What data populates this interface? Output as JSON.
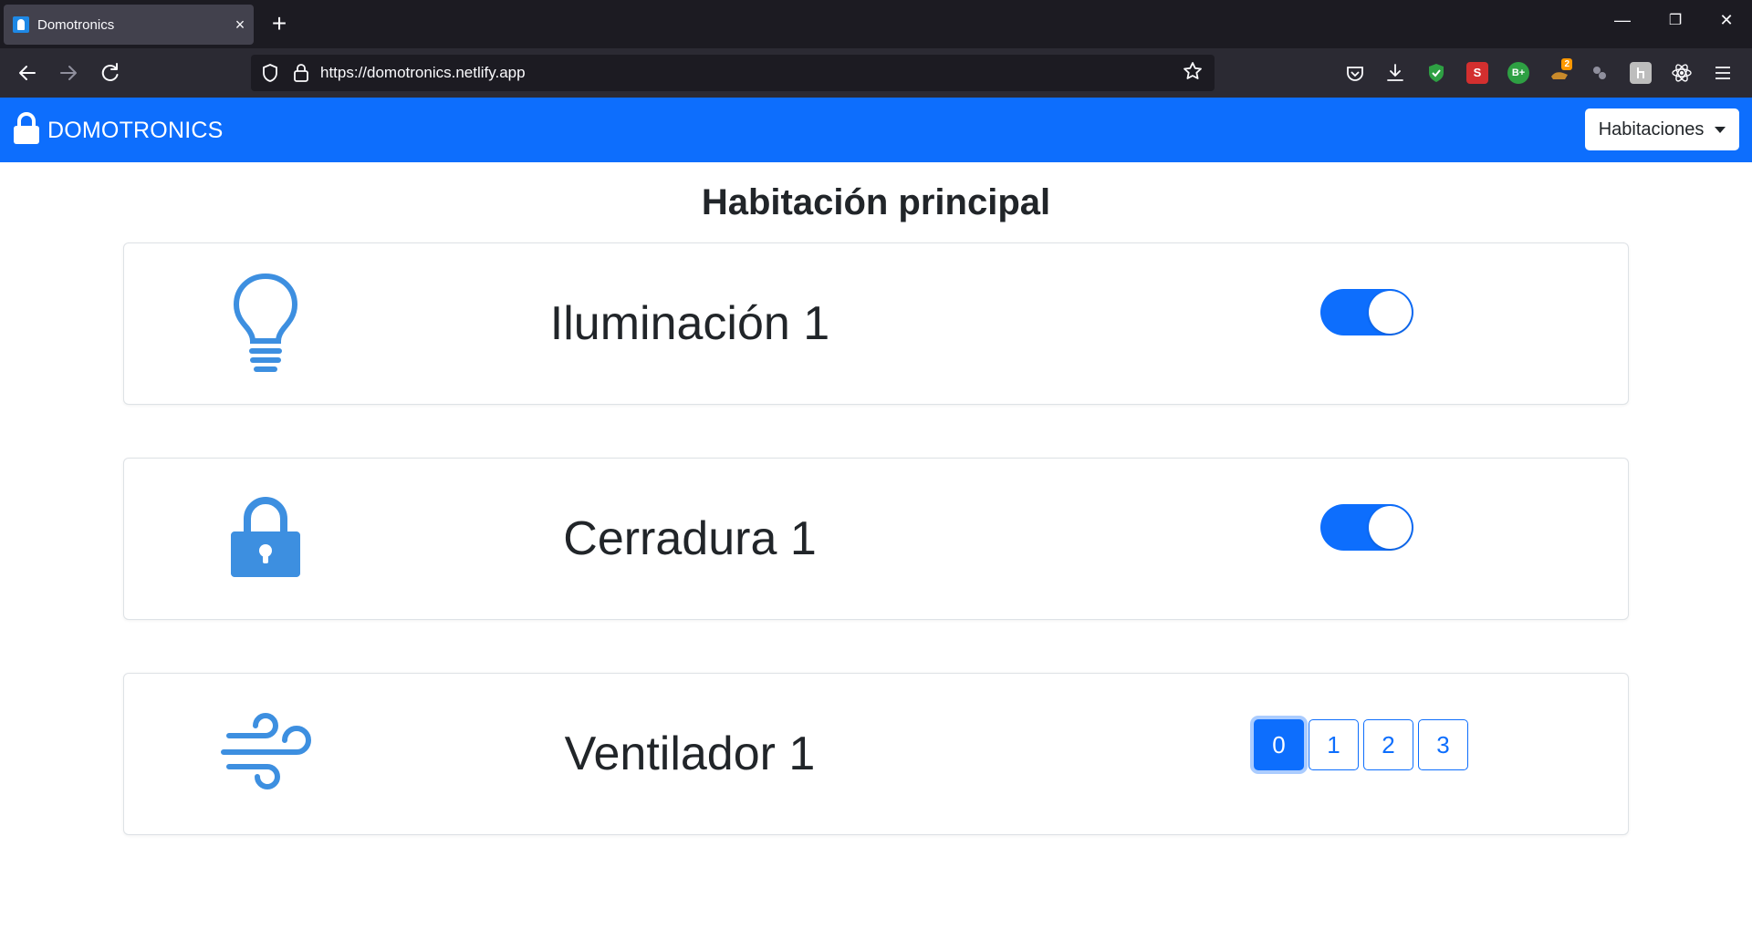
{
  "browser": {
    "tab_title": "Domotronics",
    "tab_close": "×",
    "new_tab": "+",
    "url": "https://domotronics.netlify.app",
    "window_minimize": "—",
    "window_restore": "❐",
    "window_close": "✕",
    "ext_s_label": "S",
    "ext_b_label": "B+",
    "ext_badge": "2"
  },
  "app": {
    "brand": "DOMOTRONICS",
    "dropdown_label": "Habitaciones",
    "page_title": "Habitación principal",
    "accent_color": "#0d6efd",
    "icon_color": "#3d8fe0"
  },
  "devices": [
    {
      "label": "Iluminación 1",
      "icon": "lightbulb-icon",
      "control": "switch",
      "on": true
    },
    {
      "label": "Cerradura 1",
      "icon": "lock-icon",
      "control": "switch",
      "on": true
    },
    {
      "label": "Ventilador 1",
      "icon": "wind-icon",
      "control": "speed-buttons",
      "options": [
        "0",
        "1",
        "2",
        "3"
      ],
      "selected": "0"
    }
  ]
}
